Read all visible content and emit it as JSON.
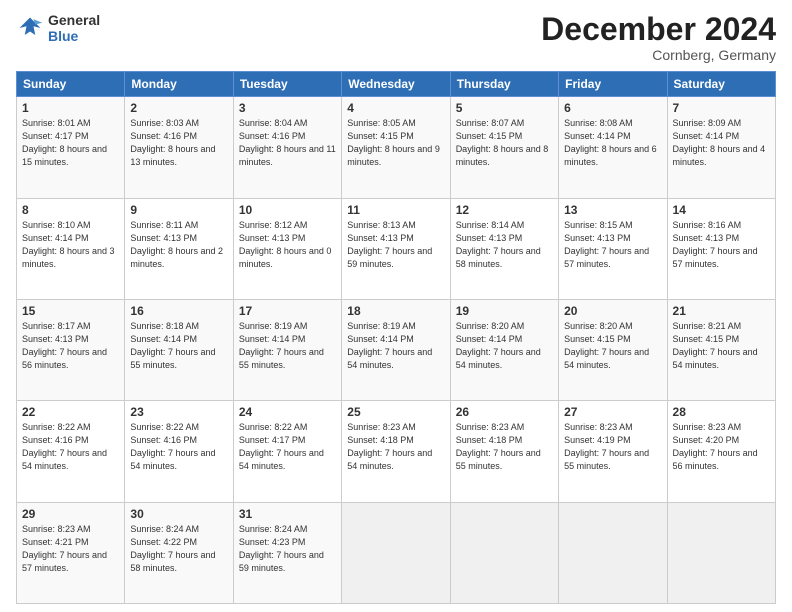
{
  "header": {
    "logo_line1": "General",
    "logo_line2": "Blue",
    "month": "December 2024",
    "location": "Cornberg, Germany"
  },
  "weekdays": [
    "Sunday",
    "Monday",
    "Tuesday",
    "Wednesday",
    "Thursday",
    "Friday",
    "Saturday"
  ],
  "weeks": [
    [
      {
        "day": "1",
        "sunrise": "Sunrise: 8:01 AM",
        "sunset": "Sunset: 4:17 PM",
        "daylight": "Daylight: 8 hours and 15 minutes."
      },
      {
        "day": "2",
        "sunrise": "Sunrise: 8:03 AM",
        "sunset": "Sunset: 4:16 PM",
        "daylight": "Daylight: 8 hours and 13 minutes."
      },
      {
        "day": "3",
        "sunrise": "Sunrise: 8:04 AM",
        "sunset": "Sunset: 4:16 PM",
        "daylight": "Daylight: 8 hours and 11 minutes."
      },
      {
        "day": "4",
        "sunrise": "Sunrise: 8:05 AM",
        "sunset": "Sunset: 4:15 PM",
        "daylight": "Daylight: 8 hours and 9 minutes."
      },
      {
        "day": "5",
        "sunrise": "Sunrise: 8:07 AM",
        "sunset": "Sunset: 4:15 PM",
        "daylight": "Daylight: 8 hours and 8 minutes."
      },
      {
        "day": "6",
        "sunrise": "Sunrise: 8:08 AM",
        "sunset": "Sunset: 4:14 PM",
        "daylight": "Daylight: 8 hours and 6 minutes."
      },
      {
        "day": "7",
        "sunrise": "Sunrise: 8:09 AM",
        "sunset": "Sunset: 4:14 PM",
        "daylight": "Daylight: 8 hours and 4 minutes."
      }
    ],
    [
      {
        "day": "8",
        "sunrise": "Sunrise: 8:10 AM",
        "sunset": "Sunset: 4:14 PM",
        "daylight": "Daylight: 8 hours and 3 minutes."
      },
      {
        "day": "9",
        "sunrise": "Sunrise: 8:11 AM",
        "sunset": "Sunset: 4:13 PM",
        "daylight": "Daylight: 8 hours and 2 minutes."
      },
      {
        "day": "10",
        "sunrise": "Sunrise: 8:12 AM",
        "sunset": "Sunset: 4:13 PM",
        "daylight": "Daylight: 8 hours and 0 minutes."
      },
      {
        "day": "11",
        "sunrise": "Sunrise: 8:13 AM",
        "sunset": "Sunset: 4:13 PM",
        "daylight": "Daylight: 7 hours and 59 minutes."
      },
      {
        "day": "12",
        "sunrise": "Sunrise: 8:14 AM",
        "sunset": "Sunset: 4:13 PM",
        "daylight": "Daylight: 7 hours and 58 minutes."
      },
      {
        "day": "13",
        "sunrise": "Sunrise: 8:15 AM",
        "sunset": "Sunset: 4:13 PM",
        "daylight": "Daylight: 7 hours and 57 minutes."
      },
      {
        "day": "14",
        "sunrise": "Sunrise: 8:16 AM",
        "sunset": "Sunset: 4:13 PM",
        "daylight": "Daylight: 7 hours and 57 minutes."
      }
    ],
    [
      {
        "day": "15",
        "sunrise": "Sunrise: 8:17 AM",
        "sunset": "Sunset: 4:13 PM",
        "daylight": "Daylight: 7 hours and 56 minutes."
      },
      {
        "day": "16",
        "sunrise": "Sunrise: 8:18 AM",
        "sunset": "Sunset: 4:14 PM",
        "daylight": "Daylight: 7 hours and 55 minutes."
      },
      {
        "day": "17",
        "sunrise": "Sunrise: 8:19 AM",
        "sunset": "Sunset: 4:14 PM",
        "daylight": "Daylight: 7 hours and 55 minutes."
      },
      {
        "day": "18",
        "sunrise": "Sunrise: 8:19 AM",
        "sunset": "Sunset: 4:14 PM",
        "daylight": "Daylight: 7 hours and 54 minutes."
      },
      {
        "day": "19",
        "sunrise": "Sunrise: 8:20 AM",
        "sunset": "Sunset: 4:14 PM",
        "daylight": "Daylight: 7 hours and 54 minutes."
      },
      {
        "day": "20",
        "sunrise": "Sunrise: 8:20 AM",
        "sunset": "Sunset: 4:15 PM",
        "daylight": "Daylight: 7 hours and 54 minutes."
      },
      {
        "day": "21",
        "sunrise": "Sunrise: 8:21 AM",
        "sunset": "Sunset: 4:15 PM",
        "daylight": "Daylight: 7 hours and 54 minutes."
      }
    ],
    [
      {
        "day": "22",
        "sunrise": "Sunrise: 8:22 AM",
        "sunset": "Sunset: 4:16 PM",
        "daylight": "Daylight: 7 hours and 54 minutes."
      },
      {
        "day": "23",
        "sunrise": "Sunrise: 8:22 AM",
        "sunset": "Sunset: 4:16 PM",
        "daylight": "Daylight: 7 hours and 54 minutes."
      },
      {
        "day": "24",
        "sunrise": "Sunrise: 8:22 AM",
        "sunset": "Sunset: 4:17 PM",
        "daylight": "Daylight: 7 hours and 54 minutes."
      },
      {
        "day": "25",
        "sunrise": "Sunrise: 8:23 AM",
        "sunset": "Sunset: 4:18 PM",
        "daylight": "Daylight: 7 hours and 54 minutes."
      },
      {
        "day": "26",
        "sunrise": "Sunrise: 8:23 AM",
        "sunset": "Sunset: 4:18 PM",
        "daylight": "Daylight: 7 hours and 55 minutes."
      },
      {
        "day": "27",
        "sunrise": "Sunrise: 8:23 AM",
        "sunset": "Sunset: 4:19 PM",
        "daylight": "Daylight: 7 hours and 55 minutes."
      },
      {
        "day": "28",
        "sunrise": "Sunrise: 8:23 AM",
        "sunset": "Sunset: 4:20 PM",
        "daylight": "Daylight: 7 hours and 56 minutes."
      }
    ],
    [
      {
        "day": "29",
        "sunrise": "Sunrise: 8:23 AM",
        "sunset": "Sunset: 4:21 PM",
        "daylight": "Daylight: 7 hours and 57 minutes."
      },
      {
        "day": "30",
        "sunrise": "Sunrise: 8:24 AM",
        "sunset": "Sunset: 4:22 PM",
        "daylight": "Daylight: 7 hours and 58 minutes."
      },
      {
        "day": "31",
        "sunrise": "Sunrise: 8:24 AM",
        "sunset": "Sunset: 4:23 PM",
        "daylight": "Daylight: 7 hours and 59 minutes."
      },
      null,
      null,
      null,
      null
    ]
  ]
}
